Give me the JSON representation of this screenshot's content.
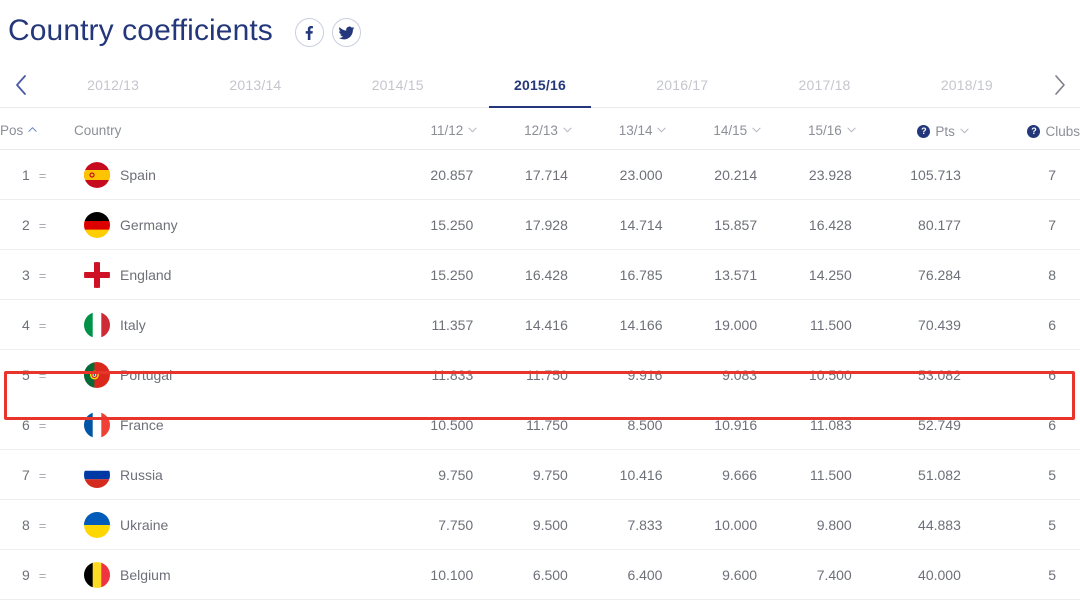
{
  "header": {
    "title": "Country coefficients",
    "social": [
      {
        "name": "facebook-icon",
        "label": "f"
      },
      {
        "name": "twitter-icon",
        "label": "t"
      }
    ]
  },
  "tabs": {
    "prev_label": "‹",
    "next_label": "›",
    "items": [
      {
        "label": "2012/13",
        "active": false
      },
      {
        "label": "2013/14",
        "active": false
      },
      {
        "label": "2014/15",
        "active": false
      },
      {
        "label": "2015/16",
        "active": true
      },
      {
        "label": "2016/17",
        "active": false
      },
      {
        "label": "2017/18",
        "active": false
      },
      {
        "label": "2018/19",
        "active": false
      }
    ]
  },
  "table": {
    "columns": [
      {
        "key": "pos",
        "label": "Pos",
        "sort": "asc",
        "help": false
      },
      {
        "key": "country",
        "label": "Country",
        "sort": "none",
        "help": false
      },
      {
        "key": "s1112",
        "label": "11/12",
        "sort": "desc",
        "help": false
      },
      {
        "key": "s1213",
        "label": "12/13",
        "sort": "desc",
        "help": false
      },
      {
        "key": "s1314",
        "label": "13/14",
        "sort": "desc",
        "help": false
      },
      {
        "key": "s1415",
        "label": "14/15",
        "sort": "desc",
        "help": false
      },
      {
        "key": "s1516",
        "label": "15/16",
        "sort": "desc",
        "help": false
      },
      {
        "key": "pts",
        "label": "Pts",
        "sort": "desc",
        "help": true
      },
      {
        "key": "clubs",
        "label": "Clubs",
        "sort": "none",
        "help": true
      }
    ],
    "help_glyph": "?",
    "rows": [
      {
        "pos": "1",
        "move": "=",
        "country": "Spain",
        "flag": "es",
        "s1112": "20.857",
        "s1213": "17.714",
        "s1314": "23.000",
        "s1415": "20.214",
        "s1516": "23.928",
        "pts": "105.713",
        "clubs": "7",
        "highlight": false
      },
      {
        "pos": "2",
        "move": "=",
        "country": "Germany",
        "flag": "de",
        "s1112": "15.250",
        "s1213": "17.928",
        "s1314": "14.714",
        "s1415": "15.857",
        "s1516": "16.428",
        "pts": "80.177",
        "clubs": "7",
        "highlight": false
      },
      {
        "pos": "3",
        "move": "=",
        "country": "England",
        "flag": "en",
        "s1112": "15.250",
        "s1213": "16.428",
        "s1314": "16.785",
        "s1415": "13.571",
        "s1516": "14.250",
        "pts": "76.284",
        "clubs": "8",
        "highlight": false
      },
      {
        "pos": "4",
        "move": "=",
        "country": "Italy",
        "flag": "it",
        "s1112": "11.357",
        "s1213": "14.416",
        "s1314": "14.166",
        "s1415": "19.000",
        "s1516": "11.500",
        "pts": "70.439",
        "clubs": "6",
        "highlight": false
      },
      {
        "pos": "5",
        "move": "=",
        "country": "Portugal",
        "flag": "pt",
        "s1112": "11.833",
        "s1213": "11.750",
        "s1314": "9.916",
        "s1415": "9.083",
        "s1516": "10.500",
        "pts": "53.082",
        "clubs": "6",
        "highlight": true
      },
      {
        "pos": "6",
        "move": "=",
        "country": "France",
        "flag": "fr",
        "s1112": "10.500",
        "s1213": "11.750",
        "s1314": "8.500",
        "s1415": "10.916",
        "s1516": "11.083",
        "pts": "52.749",
        "clubs": "6",
        "highlight": false
      },
      {
        "pos": "7",
        "move": "=",
        "country": "Russia",
        "flag": "ru",
        "s1112": "9.750",
        "s1213": "9.750",
        "s1314": "10.416",
        "s1415": "9.666",
        "s1516": "11.500",
        "pts": "51.082",
        "clubs": "5",
        "highlight": false
      },
      {
        "pos": "8",
        "move": "=",
        "country": "Ukraine",
        "flag": "ua",
        "s1112": "7.750",
        "s1213": "9.500",
        "s1314": "7.833",
        "s1415": "10.000",
        "s1516": "9.800",
        "pts": "44.883",
        "clubs": "5",
        "highlight": false
      },
      {
        "pos": "9",
        "move": "=",
        "country": "Belgium",
        "flag": "be",
        "s1112": "10.100",
        "s1213": "6.500",
        "s1314": "6.400",
        "s1415": "9.600",
        "s1516": "7.400",
        "pts": "40.000",
        "clubs": "5",
        "highlight": false
      }
    ]
  },
  "colors": {
    "brand_navy": "#24377a",
    "muted_text": "#6d7078",
    "header_text": "#8c8f98",
    "highlight_red": "#e8342a",
    "tab_inactive": "#c5c6cd"
  }
}
